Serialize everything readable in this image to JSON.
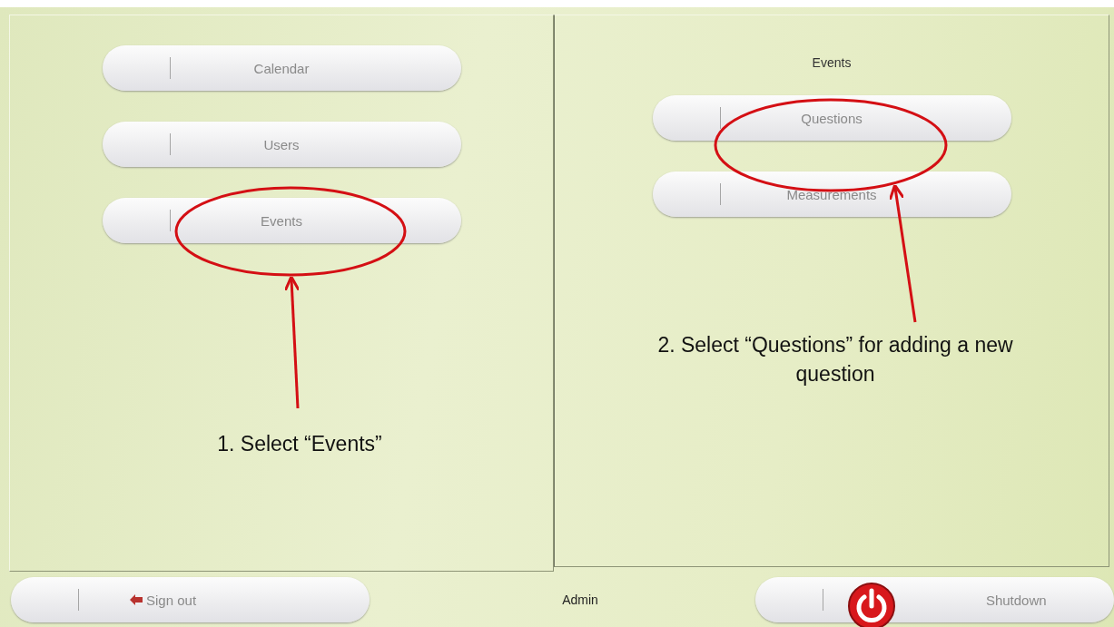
{
  "main_menu": {
    "buttons": [
      {
        "label": "Calendar"
      },
      {
        "label": "Users"
      },
      {
        "label": "Events"
      }
    ]
  },
  "submenu": {
    "title": "Events",
    "buttons": [
      {
        "label": "Questions"
      },
      {
        "label": "Measurements"
      }
    ]
  },
  "bottom_bar": {
    "sign_out": {
      "label": "Sign out"
    },
    "user": "Admin",
    "shutdown": {
      "label": "Shutdown"
    }
  },
  "annotations": [
    {
      "text": "1. Select “Events”"
    },
    {
      "text": "2. Select “Questions” for adding a new question"
    }
  ]
}
